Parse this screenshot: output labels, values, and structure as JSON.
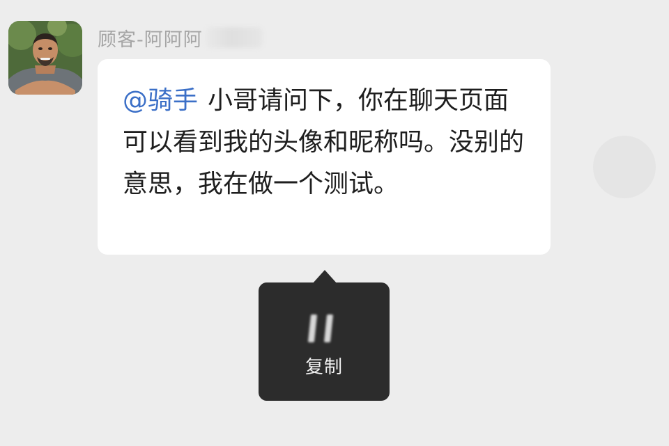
{
  "sender": {
    "name": "顾客-阿阿阿"
  },
  "message": {
    "mention": "@骑手",
    "text": "小哥请问下，你在聊天页面可以看到我的头像和昵称吗。没别的意思，我在做一个测试。"
  },
  "context_menu": {
    "items": [
      {
        "label": "复制",
        "icon": "copy-icon"
      }
    ]
  },
  "colors": {
    "background": "#ededed",
    "bubble": "#ffffff",
    "mention": "#3b6fc7",
    "menu": "#2c2c2c",
    "sender_name": "#a5a5a5"
  }
}
